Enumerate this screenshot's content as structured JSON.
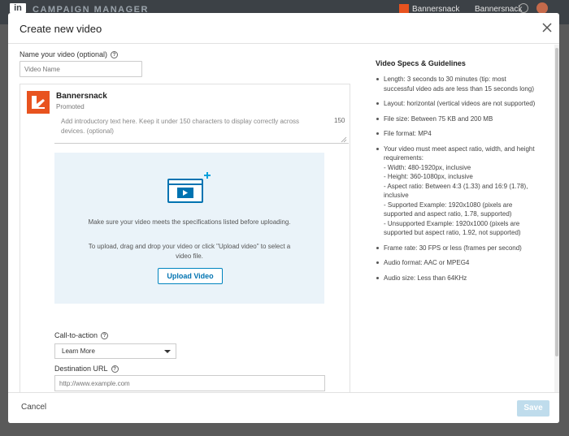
{
  "app": {
    "brand": "CAMPAIGN MANAGER",
    "account_name": "Bannersnack",
    "account_menu": "Bannersnack"
  },
  "modal": {
    "title": "Create new video",
    "video_name_label": "Name your video (optional)",
    "video_name_placeholder": "Video Name",
    "card": {
      "company": "Bannersnack",
      "promoted": "Promoted",
      "intro_placeholder": "Add introductory text here. Keep it under 150 characters to display correctly across devices. (optional)",
      "char_count": "150"
    },
    "upload": {
      "text1": "Make sure your video meets the specifications listed before uploading.",
      "text2": "To upload, drag and drop your video or click \"Upload video\" to select a video file.",
      "button": "Upload Video"
    },
    "cta": {
      "label": "Call-to-action",
      "selected": "Learn More"
    },
    "destination": {
      "label": "Destination URL",
      "placeholder": "http://www.example.com"
    },
    "footer": {
      "cancel": "Cancel",
      "save": "Save"
    }
  },
  "specs": {
    "title": "Video Specs & Guidelines",
    "items": [
      "Length: 3 seconds to 30 minutes (tip: most successful video ads are less than 15 seconds long)",
      "Layout: horizontal (vertical videos are not supported)",
      "File size: Between 75 KB and 200 MB",
      "File format: MP4",
      "Your video must meet aspect ratio, width, and height requirements:",
      "Frame rate: 30 FPS or less (frames per second)",
      "Audio format: AAC or MPEG4",
      "Audio size: Less than 64KHz"
    ],
    "aspect_sub": [
      "- Width: 480-1920px, inclusive",
      "- Height: 360-1080px, inclusive",
      "- Aspect ratio: Between 4:3 (1.33) and 16:9 (1.78), inclusive",
      "- Supported Example: 1920x1080 (pixels are supported and aspect ratio, 1.78, supported)",
      "- Unsupported Example: 1920x1000 (pixels are supported but aspect ratio, 1.92, not supported)"
    ]
  },
  "colors": {
    "brand_orange": "#e8531f",
    "link_blue": "#0073b1",
    "upload_bg": "#eaf3f9",
    "save_disabled": "#bfdcec"
  }
}
